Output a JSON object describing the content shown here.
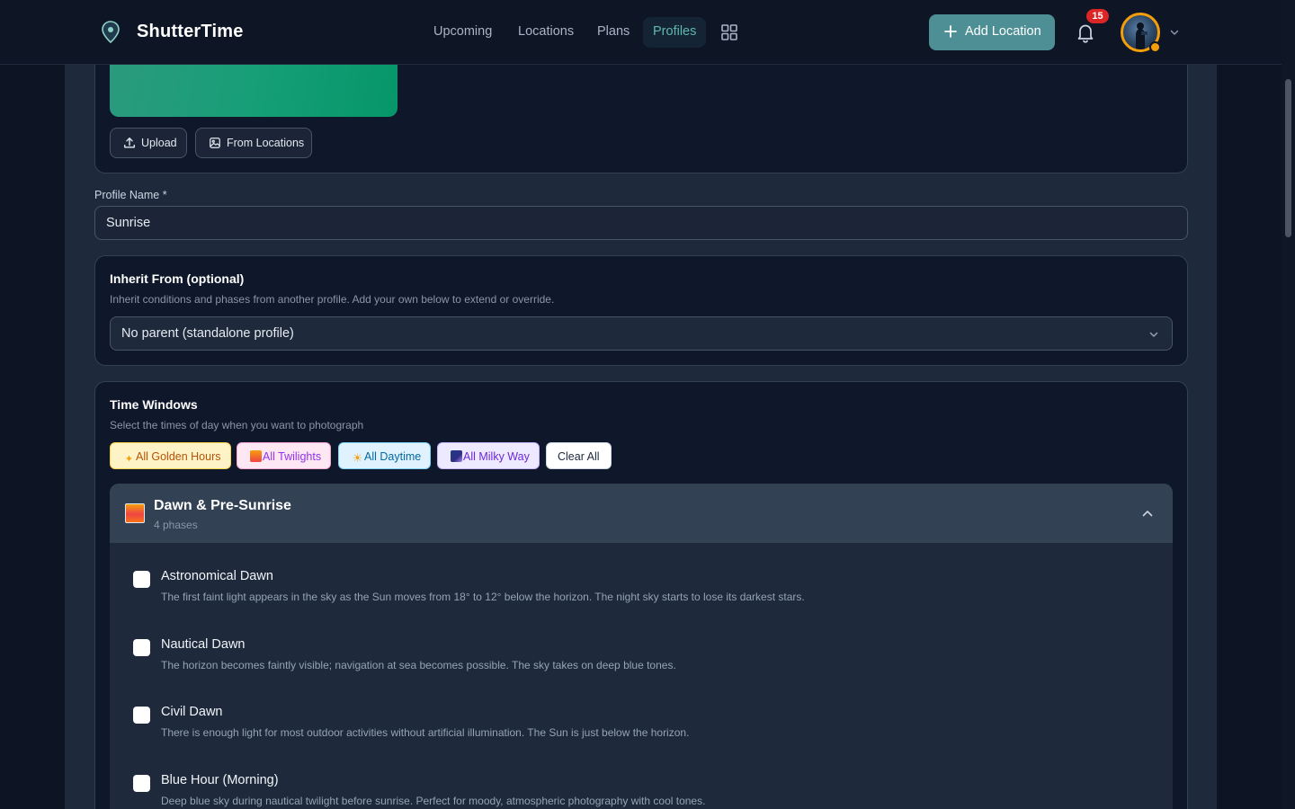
{
  "app": {
    "brand": "ShutterTime"
  },
  "nav": {
    "links": [
      "Upcoming",
      "Locations",
      "Plans"
    ],
    "active": "Profiles",
    "add_location": "Add Location",
    "notifications_count": "15"
  },
  "cover": {
    "upload_label": "Upload",
    "from_locations_label": "From Locations"
  },
  "profile_name": {
    "label": "Profile Name *",
    "value": "Sunrise"
  },
  "inherit": {
    "title": "Inherit From (optional)",
    "description": "Inherit conditions and phases from another profile. Add your own below to extend or override.",
    "selected": "No parent (standalone profile)"
  },
  "time_windows": {
    "title": "Time Windows",
    "description": "Select the times of day when you want to photograph",
    "chips": {
      "golden": "All Golden Hours",
      "twilights": "All Twilights",
      "daytime": "All Daytime",
      "milky_way": "All Milky Way",
      "clear": "Clear All"
    },
    "colors": {
      "golden_bg": "#fef3c7",
      "golden_fg": "#b45309",
      "twilight_bg": "#fce7f3",
      "twilight_fg": "#9333ea",
      "daytime_bg": "#e0f2fe",
      "daytime_fg": "#0369a1",
      "milky_bg": "#ede9fe",
      "milky_fg": "#6d28d9"
    }
  },
  "group": {
    "title": "Dawn & Pre-Sunrise",
    "subtitle": "4 phases",
    "phases": [
      {
        "title": "Astronomical Dawn",
        "description": "The first faint light appears in the sky as the Sun moves from 18° to 12° below the horizon. The night sky starts to lose its darkest stars."
      },
      {
        "title": "Nautical Dawn",
        "description": "The horizon becomes faintly visible; navigation at sea becomes possible. The sky takes on deep blue tones."
      },
      {
        "title": "Civil Dawn",
        "description": "There is enough light for most outdoor activities without artificial illumination. The Sun is just below the horizon."
      },
      {
        "title": "Blue Hour (Morning)",
        "description": "Deep blue sky during nautical twilight before sunrise. Perfect for moody, atmospheric photography with cool tones."
      }
    ]
  }
}
